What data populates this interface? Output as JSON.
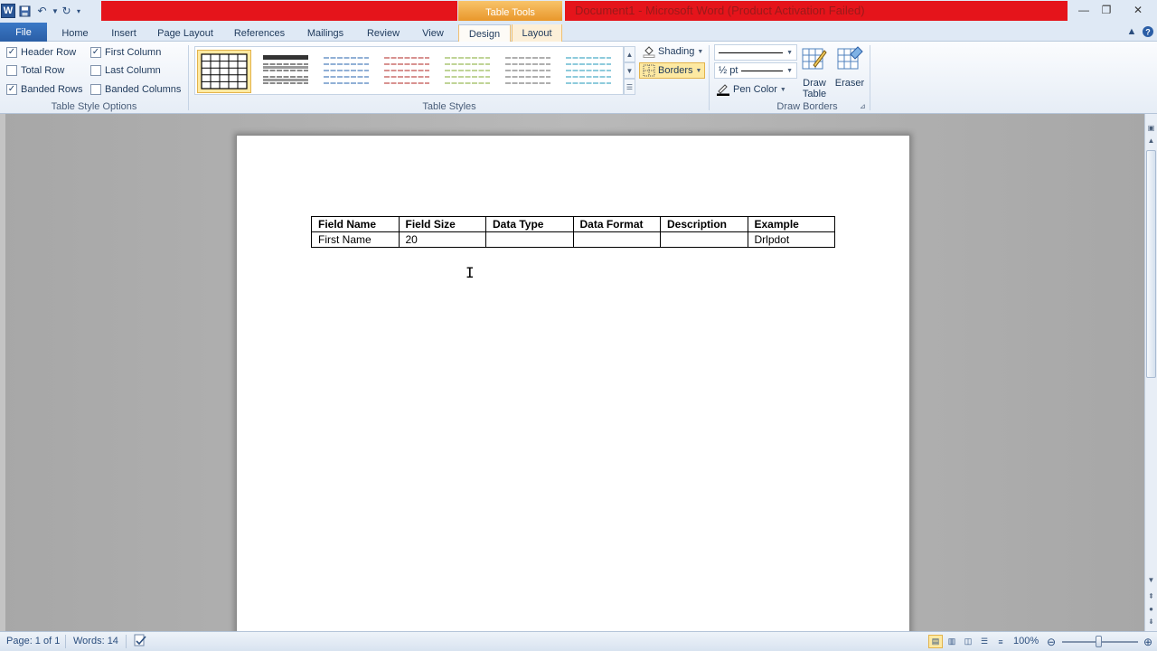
{
  "app": {
    "title": "Document1 - Microsoft Word (Product Activation Failed)",
    "context_tab": "Table Tools"
  },
  "tabs": [
    {
      "label": "File"
    },
    {
      "label": "Home"
    },
    {
      "label": "Insert"
    },
    {
      "label": "Page Layout"
    },
    {
      "label": "References"
    },
    {
      "label": "Mailings"
    },
    {
      "label": "Review"
    },
    {
      "label": "View"
    },
    {
      "label": "Design"
    },
    {
      "label": "Layout"
    }
  ],
  "active_tab": "Design",
  "style_options": {
    "group_label": "Table Style Options",
    "items": [
      {
        "label": "Header Row",
        "checked": true
      },
      {
        "label": "Total Row",
        "checked": false
      },
      {
        "label": "Banded Rows",
        "checked": true
      },
      {
        "label": "First Column",
        "checked": true
      },
      {
        "label": "Last Column",
        "checked": false
      },
      {
        "label": "Banded Columns",
        "checked": false
      }
    ]
  },
  "table_styles": {
    "group_label": "Table Styles",
    "shading_label": "Shading",
    "borders_label": "Borders",
    "thumb_colors": [
      "#000000",
      "#222222",
      "#4f81bd",
      "#c0504d",
      "#9bbb59",
      "#7f7f7f",
      "#4bacc6"
    ]
  },
  "draw_borders": {
    "group_label": "Draw Borders",
    "pen_weight": "½ pt",
    "pen_color_label": "Pen Color",
    "draw_table_label": "Draw Table",
    "eraser_label": "Eraser"
  },
  "document": {
    "table": {
      "headers": [
        "Field Name",
        "Field Size",
        "Data Type",
        "Data Format",
        "Description",
        "Example"
      ],
      "rows": [
        [
          "First Name",
          "20",
          "",
          "",
          "",
          "Drlpdot"
        ]
      ]
    }
  },
  "status": {
    "page": "Page: 1 of 1",
    "words": "Words: 14",
    "zoom": "100%"
  },
  "colors": {
    "accent_red": "#e5141b",
    "table_tools_orange": "#e9972b",
    "file_tab_blue": "#2a5ea6"
  }
}
